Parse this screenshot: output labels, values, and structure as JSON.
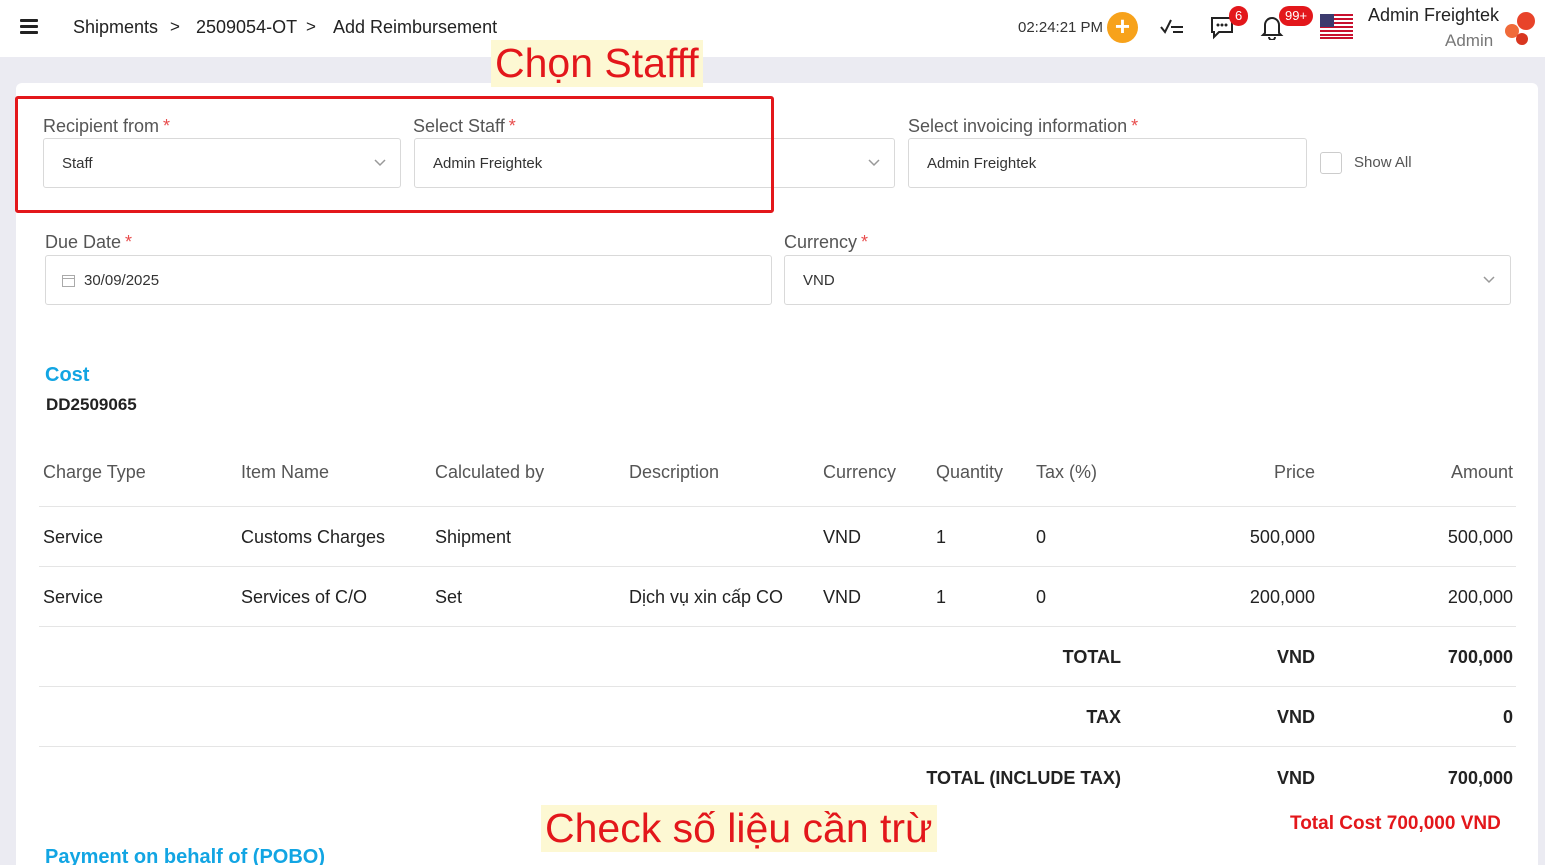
{
  "header": {
    "breadcrumb": [
      "Shipments",
      "2509054-OT",
      "Add Reimbursement"
    ],
    "separator": ">",
    "clock": "02:24:21 PM",
    "plus": "+",
    "messages_badge": "6",
    "notifications_badge": "99+",
    "user_name": "Admin Freightek",
    "user_role": "Admin"
  },
  "form": {
    "recipient_label": "Recipient from",
    "recipient_value": "Staff",
    "staff_label": "Select Staff",
    "staff_value": "Admin Freightek",
    "invoicing_label": "Select invoicing information",
    "invoicing_value": "Admin Freightek",
    "show_all": "Show All",
    "due_date_label": "Due Date",
    "due_date_value": "30/09/2025",
    "currency_label": "Currency",
    "currency_value": "VND",
    "required_mark": "*"
  },
  "cost": {
    "title": "Cost",
    "code": "DD2509065",
    "columns": [
      "Charge Type",
      "Item Name",
      "Calculated by",
      "Description",
      "Currency",
      "Quantity",
      "Tax (%)",
      "Price",
      "Amount"
    ],
    "rows": [
      [
        "Service",
        "Customs Charges",
        "Shipment",
        "",
        "VND",
        "1",
        "0",
        "500,000",
        "500,000"
      ],
      [
        "Service",
        "Services of C/O",
        "Set",
        "Dịch vụ xin cấp CO",
        "VND",
        "1",
        "0",
        "200,000",
        "200,000"
      ]
    ],
    "summary": [
      {
        "label": "TOTAL",
        "currency": "VND",
        "value": "700,000"
      },
      {
        "label": "TAX",
        "currency": "VND",
        "value": "0"
      },
      {
        "label": "TOTAL (INCLUDE TAX)",
        "currency": "VND",
        "value": "700,000"
      }
    ],
    "total_cost_label": "Total Cost",
    "total_cost_value": "700,000 VND"
  },
  "pobo_title": "Payment on behalf of (POBO)",
  "annotations": {
    "choose_staff": "Chọn Stafff",
    "check_numbers": "Check số liệu cần trừ"
  },
  "colors": {
    "accent": "#12a5e3",
    "danger": "#e3171b",
    "orange": "#f7a21b"
  }
}
